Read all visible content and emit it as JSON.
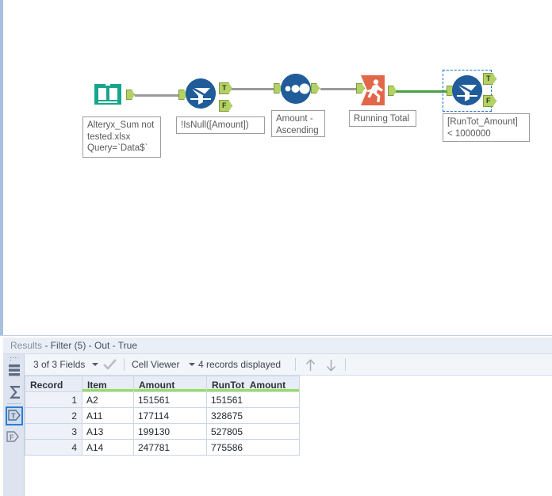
{
  "app": {
    "canvas_background": "#ffffff",
    "accent_blue": "#1f5c99",
    "accent_green": "#4aa03f",
    "anchor_green": "#b3d165",
    "selection_color": "#1a6fd4"
  },
  "workflow": {
    "tools": [
      {
        "id": "input-data",
        "type": "input-data-tool",
        "icon": "open-book-icon",
        "color": "#17a68c",
        "selected": false,
        "annotation": "Alteryx_Sum not\ntested.xlsx\nQuery=`Data$`"
      },
      {
        "id": "filter-1",
        "type": "filter-tool",
        "icon": "funnel-icon",
        "color": "#1f5c99",
        "selected": false,
        "annotation": "!IsNull([Amount])",
        "outputs": [
          "T",
          "F"
        ]
      },
      {
        "id": "sort",
        "type": "sort-tool",
        "icon": "three-dots-icon",
        "color": "#1f5c99",
        "selected": false,
        "annotation": "Amount -\nAscending"
      },
      {
        "id": "running-total",
        "type": "running-total-tool",
        "icon": "runner-icon",
        "color": "#e2674a",
        "selected": false,
        "annotation": "Running Total"
      },
      {
        "id": "filter-2",
        "type": "filter-tool",
        "icon": "funnel-icon",
        "color": "#1f5c99",
        "selected": true,
        "annotation": "[RunTot_Amount]\n< 1000000",
        "outputs": [
          "T",
          "F"
        ]
      }
    ],
    "anchor_labels": {
      "true": "T",
      "false": "F"
    }
  },
  "results": {
    "title_prefix": "Results",
    "title_rest": " - Filter (5) - Out - True",
    "title_full": "Results - Filter (5) - Out - True",
    "rail": {
      "items": [
        {
          "name": "grip-handle",
          "label": ""
        },
        {
          "name": "record-list-icon",
          "label": ""
        },
        {
          "name": "sigma-icon",
          "label": "∑"
        },
        {
          "name": "true-anchor-icon",
          "label": "T",
          "selected": true
        },
        {
          "name": "false-anchor-icon",
          "label": "F",
          "selected": false
        }
      ]
    },
    "toolbar": {
      "fields_label": "3 of 3 Fields",
      "check_icon": "checkmark-icon",
      "viewer_label": "Cell Viewer",
      "records_label": "4 records displayed",
      "up_icon": "arrow-up-icon",
      "down_icon": "arrow-down-icon"
    },
    "table": {
      "columns": [
        "Record",
        "Item",
        "Amount",
        "RunTot_Amount"
      ],
      "rows": [
        {
          "Record": "1",
          "Item": "A2",
          "Amount": "151561",
          "RunTot_Amount": "151561"
        },
        {
          "Record": "2",
          "Item": "A11",
          "Amount": "177114",
          "RunTot_Amount": "328675"
        },
        {
          "Record": "3",
          "Item": "A13",
          "Amount": "199130",
          "RunTot_Amount": "527805"
        },
        {
          "Record": "4",
          "Item": "A14",
          "Amount": "247781",
          "RunTot_Amount": "775586"
        }
      ]
    }
  }
}
